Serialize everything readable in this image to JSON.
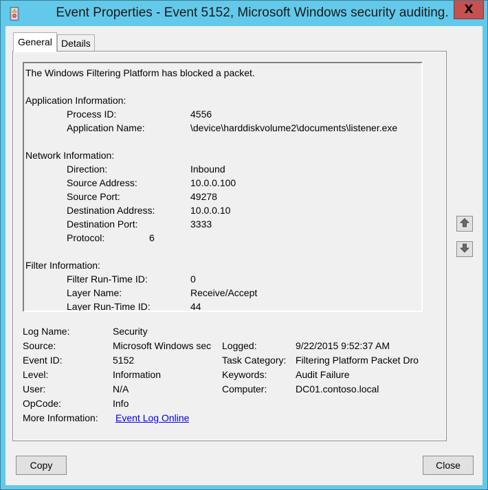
{
  "window": {
    "title": "Event Properties - Event 5152, Microsoft Windows security auditing.",
    "close_glyph": "X",
    "accent_color": "#63c9ea",
    "close_color": "#c75050"
  },
  "tabs": [
    {
      "label": "General",
      "active": true
    },
    {
      "label": "Details",
      "active": false
    }
  ],
  "description": {
    "summary": "The Windows Filtering Platform has blocked a packet.",
    "sections": [
      {
        "heading": "Application Information:",
        "fields": [
          {
            "key": "Process ID:",
            "value": "4556"
          },
          {
            "key": "Application Name:",
            "value": "\\device\\harddiskvolume2\\documents\\listener.exe"
          }
        ]
      },
      {
        "heading": "Network Information:",
        "fields": [
          {
            "key": "Direction:",
            "value": "Inbound"
          },
          {
            "key": "Source Address:",
            "value": "10.0.0.100"
          },
          {
            "key": "Source Port:",
            "value": "49278"
          },
          {
            "key": "Destination Address:",
            "value": "10.0.0.10"
          },
          {
            "key": "Destination Port:",
            "value": "3333"
          },
          {
            "key": "Protocol:",
            "value": "6"
          }
        ]
      },
      {
        "heading": "Filter Information:",
        "fields": [
          {
            "key": "Filter Run-Time ID:",
            "value": "0"
          },
          {
            "key": "Layer Name:",
            "value": "Receive/Accept"
          },
          {
            "key": "Layer Run-Time ID:",
            "value": "44"
          }
        ]
      }
    ]
  },
  "scroll": {
    "up_icon": "arrow-up-icon",
    "down_icon": "arrow-down-icon"
  },
  "meta": {
    "log_name": {
      "label": "Log Name:",
      "value": "Security"
    },
    "source": {
      "label": "Source:",
      "value": "Microsoft Windows sec"
    },
    "event_id": {
      "label": "Event ID:",
      "value": "5152"
    },
    "level": {
      "label": "Level:",
      "value": "Information"
    },
    "user": {
      "label": "User:",
      "value": "N/A"
    },
    "opcode": {
      "label": "OpCode:",
      "value": "Info"
    },
    "more_info": {
      "label": "More Information:",
      "value": "Event Log Online "
    },
    "logged": {
      "label": "Logged:",
      "value": "9/22/2015 9:52:37 AM"
    },
    "task_category": {
      "label": "Task Category:",
      "value": "Filtering Platform Packet Dro"
    },
    "keywords": {
      "label": "Keywords:",
      "value": "Audit Failure"
    },
    "computer": {
      "label": "Computer:",
      "value": "DC01.contoso.local"
    }
  },
  "buttons": {
    "copy": "Copy",
    "close": "Close"
  }
}
